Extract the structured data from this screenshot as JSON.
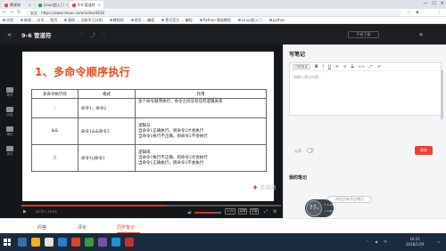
{
  "browser": {
    "tabs": [
      {
        "label": "慕课网",
        "active": false
      },
      {
        "label": "Linux超入门",
        "active": false
      },
      {
        "label": "9-6 管道符",
        "active": true
      }
    ],
    "window_controls": [
      "—",
      "☐",
      "✕"
    ],
    "security_label": "安全",
    "url": "https://www.imooc.com/video/4630",
    "bookmarks": [
      "应用",
      "新课 … 口号 … 首页",
      "我的 … 全新学习计划",
      "教程网",
      "首页 … 编程",
      "黑马官方 … 编程",
      "Python 基础教程",
      "Linux超入门",
      "python"
    ]
  },
  "header": {
    "back_icon": "<",
    "video_title": "9-6 管道符",
    "download_label": "手机下载"
  },
  "sidebar": {
    "items": [
      "章节",
      "问答",
      "笔记",
      "评论"
    ]
  },
  "slide": {
    "title": "1、多命令顺序执行",
    "table": {
      "headers": [
        "多命令执行符",
        "格式",
        "作用"
      ],
      "rows": [
        {
          "op": ";",
          "format": "命令1；命令2",
          "effect": [
            "多个命令顺序执行，命令之间没有任何逻辑关系"
          ]
        },
        {
          "op": "&&",
          "format": "命令1&&命令2",
          "effect": [
            "逻辑与",
            "当命令1正确执行，则命令2才会执行",
            "当命令1执行不正确，则命令2不会执行"
          ]
        },
        {
          "op": "||",
          "format": "命令1||命令2",
          "effect": [
            "逻辑或",
            "当命令1执行不正确，则命令2才会执行",
            "当命令1正确执行，则命令2不会执行"
          ]
        }
      ]
    },
    "watermark": "慕课网"
  },
  "player": {
    "time": "05:37 / 10:03",
    "progress": 0.56,
    "volume": 0.7,
    "buttons": [
      "1.0x",
      "高清",
      "字幕"
    ]
  },
  "notes": {
    "heading": "写笔记",
    "toolbar": {
      "code_select": "代码语言",
      "icons": [
        "B",
        "I",
        "U",
        "≡",
        "≡",
        "S",
        "<>",
        "⤢",
        "↺"
      ]
    },
    "placeholder": "请输入笔记内容...",
    "public_label": "公开",
    "save_label": "保存",
    "my_notes_heading": "我的笔记",
    "empty_label": "你还没有写过笔记"
  },
  "network_badge": {
    "percent": "77",
    "unit": "%",
    "up": "↑ 0.1k/s",
    "down": "↓ 0.8k/s"
  },
  "bottom_tabs": [
    "问答",
    "评论",
    "同学笔记"
  ],
  "taskbar": {
    "time": "16:21",
    "date": "2018/1/29"
  },
  "colors": {
    "accent": "#f03f2c",
    "slide_title": "#e84a1f",
    "header_bg": "#1c1f21",
    "taskbar_bg": "#1a2b3c"
  }
}
